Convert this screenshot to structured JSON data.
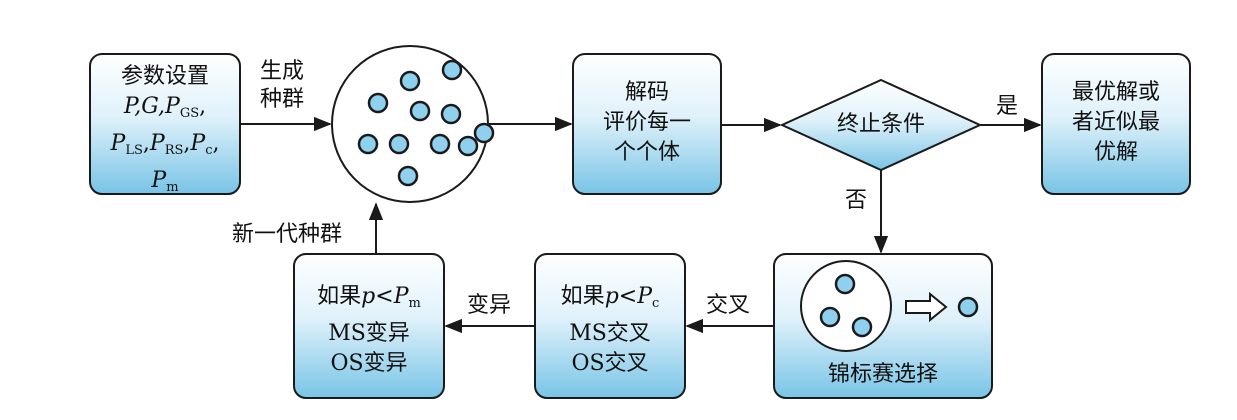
{
  "params_box": {
    "title": "参数设置",
    "l2_a": "P",
    "l2_b": ",G,",
    "l2_c": "P",
    "l2_c_sub": "GS",
    "l2_d": ",",
    "l3_a": "P",
    "l3_a_sub": "LS",
    "l3_b": ",",
    "l3_c": "P",
    "l3_c_sub": "RS",
    "l3_d": ",",
    "l3_e": "P",
    "l3_e_sub": "c",
    "l3_f": ",",
    "l4_a": "P",
    "l4_a_sub": "m"
  },
  "arrow_generate": {
    "line1": "生成",
    "line2": "种群"
  },
  "decode_box": {
    "line1": "解码",
    "line2": "评价每一",
    "line3": "个个体"
  },
  "terminate_diamond": {
    "label": "终止条件"
  },
  "arrow_yes": {
    "label": "是"
  },
  "arrow_no": {
    "label": "否"
  },
  "result_box": {
    "line1": "最优解或",
    "line2": "者近似最",
    "line3": "优解"
  },
  "tournament_box": {
    "label": "锦标赛选择"
  },
  "arrow_crossover": {
    "label": "交叉"
  },
  "crossover_box": {
    "l1_a": "如果",
    "l1_b": "p",
    "l1_c": "<",
    "l1_d": "P",
    "l1_d_sub": "c",
    "line2": "MS交叉",
    "line3": "OS交叉"
  },
  "arrow_mutation": {
    "label": "变异"
  },
  "mutation_box": {
    "l1_a": "如果",
    "l1_b": "p",
    "l1_c": "<",
    "l1_d": "P",
    "l1_d_sub": "m",
    "line2": "MS变异",
    "line3": "OS变异"
  },
  "arrow_new_gen": {
    "label": "新一代种群"
  },
  "colors": {
    "box_top": "#ffffff",
    "box_bottom": "#78c4e6",
    "stroke": "#1a1a1a",
    "dot_fill": "#8fd0ef"
  }
}
